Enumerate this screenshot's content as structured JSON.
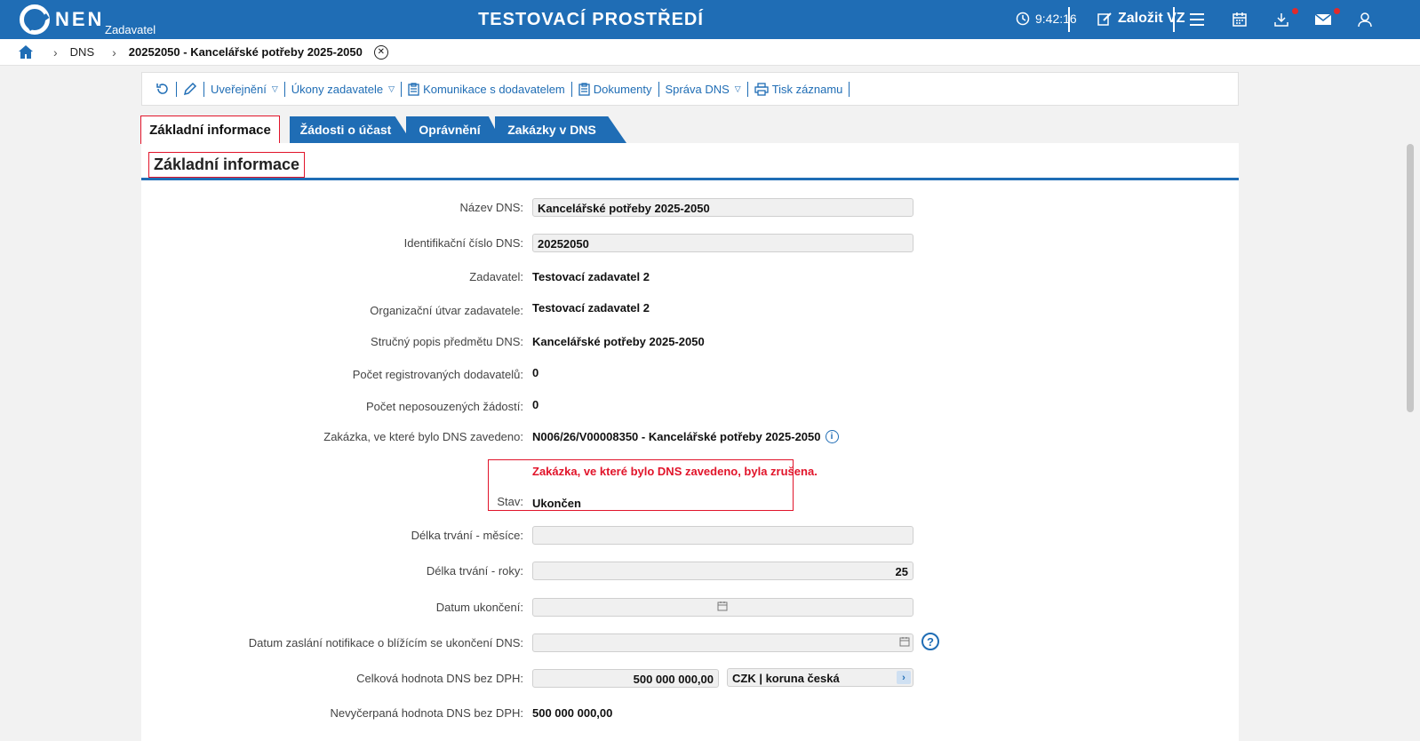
{
  "header": {
    "logo_text": "NEN",
    "logo_sub": "Zadavatel",
    "env_title": "TESTOVACÍ PROSTŘEDÍ",
    "clock": "9:42:16",
    "create_label": "Založit VZ",
    "icons": [
      "clock-icon",
      "edit-icon",
      "menu-icon",
      "calendar-icon",
      "download-icon",
      "mail-icon",
      "user-icon"
    ]
  },
  "breadcrumb": {
    "items": [
      "DNS"
    ],
    "current": "20252050 - Kancelářské potřeby 2025-2050"
  },
  "toolbar": {
    "publish": "Uveřejnění",
    "actions": "Úkony zadavatele",
    "communication": "Komunikace s dodavatelem",
    "documents": "Dokumenty",
    "dns_admin": "Správa DNS",
    "print": "Tisk záznamu"
  },
  "tabs": {
    "basic": "Základní informace",
    "requests": "Žádosti o účast",
    "permissions": "Oprávnění",
    "contracts": "Zakázky v DNS"
  },
  "section_title": "Základní informace",
  "form": {
    "name_label": "Název DNS:",
    "name_value": "Kancelářské potřeby 2025-2050",
    "id_label": "Identifikační číslo DNS:",
    "id_value": "20252050",
    "authority_label": "Zadavatel:",
    "authority_value": "Testovací zadavatel 2",
    "unit_label": "Organizační útvar zadavatele:",
    "unit_value": "Testovací zadavatel 2",
    "desc_label": "Stručný popis předmětu DNS:",
    "desc_value": "Kancelářské potřeby 2025-2050",
    "suppliers_label": "Počet registrovaných dodavatelů:",
    "suppliers_value": "0",
    "pending_label": "Počet neposouzených žádostí:",
    "pending_value": "0",
    "contract_label": "Zakázka, ve které bylo DNS zavedeno:",
    "contract_value": "N006/26/V00008350 - Kancelářské potřeby 2025-2050",
    "warning": "Zakázka, ve které bylo DNS zavedeno, byla zrušena.",
    "status_label": "Stav:",
    "status_value": "Ukončen",
    "months_label": "Délka trvání - měsíce:",
    "months_value": "",
    "years_label": "Délka trvání - roky:",
    "years_value": "25",
    "end_label": "Datum ukončení:",
    "end_value": "",
    "notify_label": "Datum zaslání notifikace o blížícím se ukončení DNS:",
    "notify_value": "",
    "total_label": "Celková hodnota DNS bez DPH:",
    "total_value": "500 000 000,00",
    "currency_value": "CZK | koruna česká",
    "remaining_label": "Nevyčerpaná hodnota DNS bez DPH:",
    "remaining_value": "500 000 000,00"
  },
  "colors": {
    "brand": "#1f6db5",
    "highlight": "#e1142a",
    "badge": "#e12a2a"
  }
}
